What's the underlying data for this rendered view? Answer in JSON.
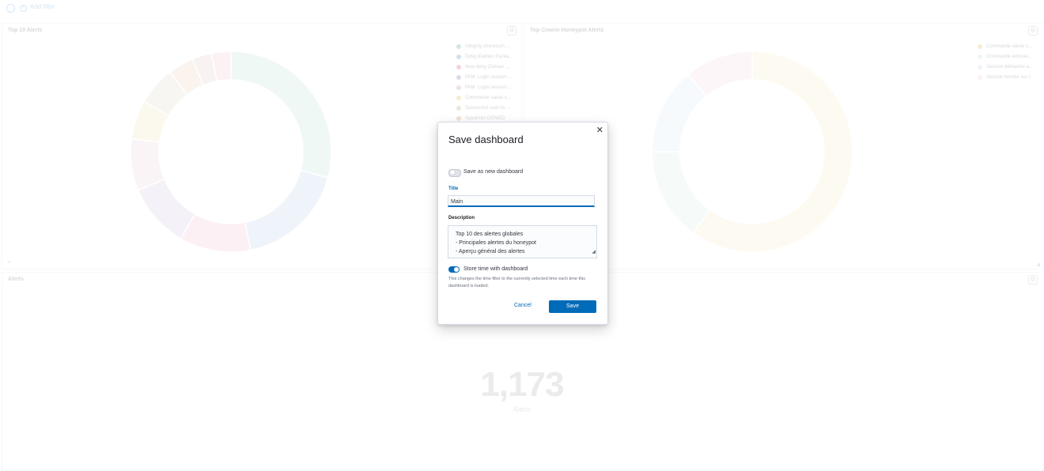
{
  "filter_bar": {
    "add_filter_label": "Add filter"
  },
  "panels": {
    "top_alerts": {
      "title": "Top 10 Alerts",
      "legend": [
        {
          "label": "Integrity checksum ...",
          "color": "#54b399"
        },
        {
          "label": "Dpkg (Debian Packa...",
          "color": "#6092c0"
        },
        {
          "label": "New dpkg (Debian ...",
          "color": "#d36086"
        },
        {
          "label": "PAM: Login session ...",
          "color": "#9170b8"
        },
        {
          "label": "PAM: Login session ...",
          "color": "#ca8eae"
        },
        {
          "label": "Commande saisie s...",
          "color": "#d6bf57"
        },
        {
          "label": "Successful sudo to ...",
          "color": "#b9a888"
        },
        {
          "label": "Apparmor DENIED",
          "color": "#da8b45"
        }
      ],
      "donut": [
        {
          "value": 28,
          "color": "#c9e8de"
        },
        {
          "value": 17,
          "color": "#c6d9ec"
        },
        {
          "value": 11,
          "color": "#f3c9d6"
        },
        {
          "value": 10,
          "color": "#d7cdea"
        },
        {
          "value": 8,
          "color": "#ecd6e2"
        },
        {
          "value": 6,
          "color": "#f0e8bd"
        },
        {
          "value": 6,
          "color": "#e7e0d4"
        },
        {
          "value": 4,
          "color": "#f1d7c2"
        },
        {
          "value": 3,
          "color": "#e6d2cf"
        },
        {
          "value": 3,
          "color": "#f6d1d6"
        }
      ]
    },
    "cowrie_alerts": {
      "title": "Top Cowrie Honeypot Alerts",
      "legend": [
        {
          "label": "Commande saisie s...",
          "color": "#d6bf57"
        },
        {
          "label": "Commande échoué...",
          "color": "#b9e3d5"
        },
        {
          "label": "Session démarrée a...",
          "color": "#c6d9ec"
        },
        {
          "label": "Session fermée sur l...",
          "color": "#f3c9d6"
        }
      ],
      "donut": [
        {
          "value": 60,
          "color": "#f3ebcd"
        },
        {
          "value": 15,
          "color": "#dff0ea"
        },
        {
          "value": 14,
          "color": "#e3ebf5"
        },
        {
          "value": 11,
          "color": "#f7dde4"
        }
      ]
    },
    "alerts_metric": {
      "title": "Alerts",
      "value": "1,173",
      "label": "Alerts"
    }
  },
  "modal": {
    "title": "Save dashboard",
    "save_as_new_label": "Save as new dashboard",
    "save_as_new_checked": false,
    "title_field_label": "Title",
    "title_value": "Main",
    "description_label": "Description",
    "description_lines": [
      "Top 10 des alertes globales",
      "- Principales alertes du honeypot",
      "- Aperçu général des alertes"
    ],
    "store_time_label": "Store time with dashboard",
    "store_time_checked": true,
    "store_time_help": "This changes the time filter to the currently selected time each time this dashboard is loaded.",
    "cancel_label": "Cancel",
    "save_label": "Save"
  }
}
